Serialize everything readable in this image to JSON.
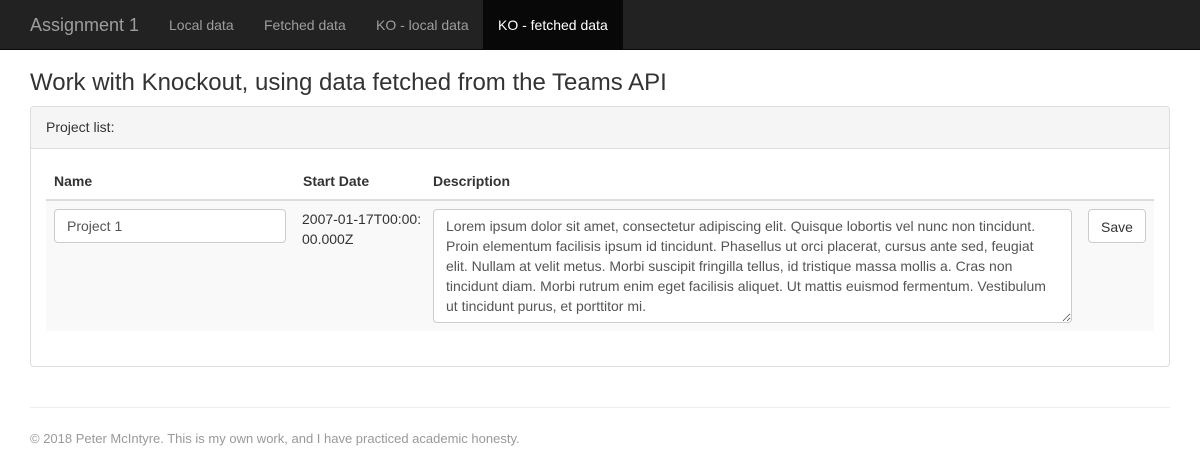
{
  "nav": {
    "brand": "Assignment 1",
    "links": [
      {
        "label": "Local data"
      },
      {
        "label": "Fetched data"
      },
      {
        "label": "KO - local data"
      },
      {
        "label": "KO - fetched data",
        "active": true
      }
    ]
  },
  "page": {
    "title": "Work with Knockout, using data fetched from the Teams API"
  },
  "panel": {
    "heading": "Project list:",
    "columns": [
      "Name",
      "Start Date",
      "Description"
    ],
    "rows": [
      {
        "name": "Project 1",
        "start_date": "2007-01-17T00:00:00.000Z",
        "description": "Lorem ipsum dolor sit amet, consectetur adipiscing elit. Quisque lobortis vel nunc non tincidunt. Proin elementum facilisis ipsum id tincidunt. Phasellus ut orci placerat, cursus ante sed, feugiat elit. Nullam at velit metus. Morbi suscipit fringilla tellus, id tristique massa mollis a. Cras non tincidunt diam. Morbi rutrum enim eget facilisis aliquet. Ut mattis euismod fermentum. Vestibulum ut tincidunt purus, et porttitor mi.",
        "save_label": "Save"
      }
    ]
  },
  "footer": {
    "text": "© 2018 Peter McIntyre. This is my own work, and I have practiced academic honesty."
  }
}
